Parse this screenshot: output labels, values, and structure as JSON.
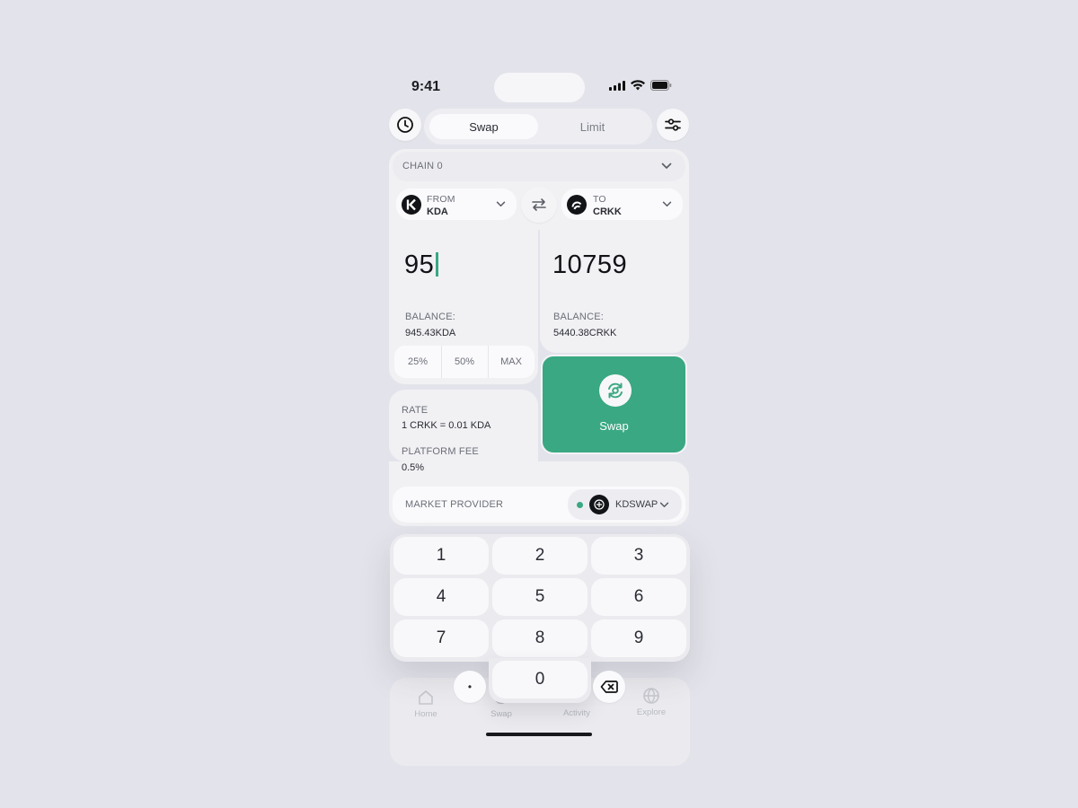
{
  "status_bar": {
    "time": "9:41"
  },
  "header": {
    "history_icon": "clock-icon",
    "settings_icon": "sliders-icon",
    "tabs": [
      {
        "label": "Swap",
        "active": true
      },
      {
        "label": "Limit",
        "active": false
      }
    ]
  },
  "chain": {
    "label": "CHAIN 0"
  },
  "from": {
    "label": "FROM",
    "token": "KDA",
    "amount": "95",
    "balance_label": "BALANCE:",
    "balance": "945.43KDA"
  },
  "to": {
    "label": "TO",
    "token": "CRKK",
    "amount": "10759",
    "balance_label": "BALANCE:",
    "balance": "5440.38CRKK"
  },
  "percent_buttons": [
    "25%",
    "50%",
    "MAX"
  ],
  "swap_button": {
    "label": "Swap"
  },
  "rate": {
    "label": "RATE",
    "value": "1 CRKK = 0.01 KDA"
  },
  "fee": {
    "label": "PLATFORM FEE",
    "value": "0.5%"
  },
  "market_provider": {
    "label": "MARKET PROVIDER",
    "value": "KDSWAP"
  },
  "keypad": {
    "keys": [
      "1",
      "2",
      "3",
      "4",
      "5",
      "6",
      "7",
      "8",
      "9",
      "0"
    ],
    "dot": "•"
  },
  "nav": [
    {
      "label": "Home"
    },
    {
      "label": "Swap"
    },
    {
      "label": "Activity"
    },
    {
      "label": "Explore"
    }
  ],
  "colors": {
    "accent": "#3aa882",
    "background": "#e3e4eb",
    "card": "#f1f1f4"
  }
}
